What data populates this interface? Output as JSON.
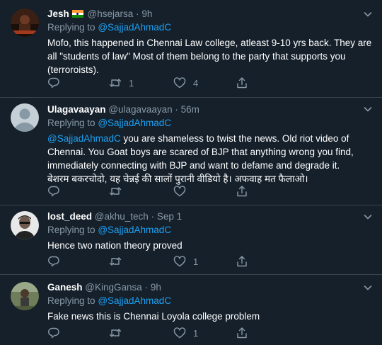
{
  "tweets": [
    {
      "name": "Jesh",
      "handle": "@hsejarsa",
      "sep": "·",
      "time": "9h",
      "replying_prefix": "Replying to",
      "replying_to": "@SajjadAhmadC",
      "mention_prefix": "",
      "text": "Mofo, this happened in Chennai Law college, atleast 9-10 yrs back. They are all \"students of law\" Most of them belong to the party that supports you (terroroists).",
      "text_line2": "",
      "replies": "",
      "retweets": "1",
      "likes": "4"
    },
    {
      "name": "Ulagavaayan",
      "handle": "@ulagavaayan",
      "sep": "·",
      "time": "56m",
      "replying_prefix": "Replying to",
      "replying_to": "@SajjadAhmadC",
      "mention_prefix": "@SajjadAhmadC",
      "text": " you are shameless to twist the news. Old riot video of Chennai. You Goat boys are scared of BJP that anything wrong you find, immediately connecting with BJP and want to defame and degrade it.",
      "text_line2": "बेशरम बकरचोदो, यह चेन्नई की सालों पुरानी वीडियो है। अफवाह मत फैलाओ।",
      "replies": "",
      "retweets": "",
      "likes": ""
    },
    {
      "name": "lost_deed",
      "handle": "@akhu_tech",
      "sep": "·",
      "time": "Sep 1",
      "replying_prefix": "Replying to",
      "replying_to": "@SajjadAhmadC",
      "mention_prefix": "",
      "text": "Hence two nation theory proved",
      "text_line2": "",
      "replies": "",
      "retweets": "",
      "likes": "1"
    },
    {
      "name": "Ganesh",
      "handle": "@KingGansa",
      "sep": "·",
      "time": "9h",
      "replying_prefix": "Replying to",
      "replying_to": "@SajjadAhmadC",
      "mention_prefix": "",
      "text": "Fake news this is Chennai Loyola college problem",
      "text_line2": "",
      "replies": "",
      "retweets": "",
      "likes": "1"
    }
  ],
  "icons": {
    "reply": "reply-icon",
    "retweet": "retweet-icon",
    "like": "heart-icon",
    "share": "share-icon",
    "more": "chevron-down-icon"
  },
  "colors": {
    "background": "#15202b",
    "secondary_text": "#8899a6",
    "accent": "#1da1f2",
    "divider": "#38444d"
  }
}
